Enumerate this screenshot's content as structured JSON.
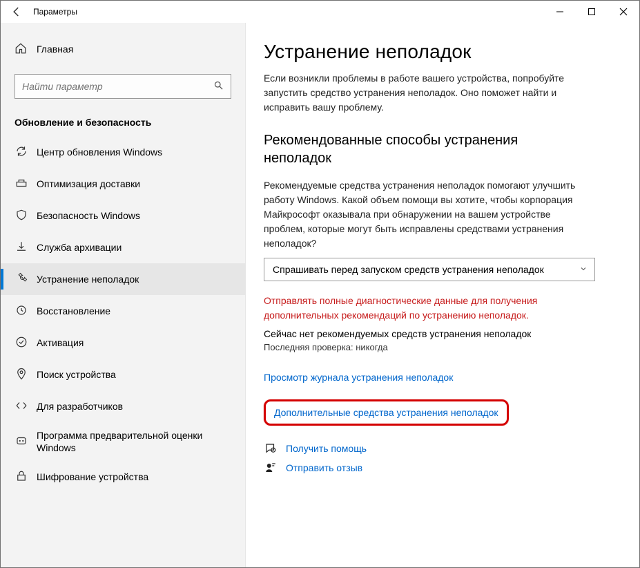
{
  "window": {
    "title": "Параметры"
  },
  "sidebar": {
    "home": "Главная",
    "search_placeholder": "Найти параметр",
    "category": "Обновление и безопасность",
    "items": [
      {
        "label": "Центр обновления Windows"
      },
      {
        "label": "Оптимизация доставки"
      },
      {
        "label": "Безопасность Windows"
      },
      {
        "label": "Служба архивации"
      },
      {
        "label": "Устранение неполадок"
      },
      {
        "label": "Восстановление"
      },
      {
        "label": "Активация"
      },
      {
        "label": "Поиск устройства"
      },
      {
        "label": "Для разработчиков"
      },
      {
        "label": "Программа предварительной оценки Windows"
      },
      {
        "label": "Шифрование устройства"
      }
    ]
  },
  "main": {
    "title": "Устранение неполадок",
    "lead": "Если возникли проблемы в работе вашего устройства, попробуйте запустить средство устранения неполадок. Оно поможет найти и исправить вашу проблему.",
    "section_title": "Рекомендованные способы устранения неполадок",
    "section_text": "Рекомендуемые средства устранения неполадок помогают улучшить работу Windows. Какой объем помощи вы хотите, чтобы корпорация Майкрософт оказывала при обнаружении на вашем устройстве проблем, которые могут быть исправлены средствами устранения неполадок?",
    "dropdown_value": "Спрашивать перед запуском средств устранения неполадок",
    "warn": "Отправлять полные диагностические данные для получения дополнительных рекомендаций по устранению неполадок.",
    "status": "Сейчас нет рекомендуемых средств устранения неполадок",
    "meta": "Последняя проверка: никогда",
    "link_history": "Просмотр журнала устранения неполадок",
    "link_additional": "Дополнительные средства устранения неполадок",
    "help": "Получить помощь",
    "feedback": "Отправить отзыв"
  }
}
